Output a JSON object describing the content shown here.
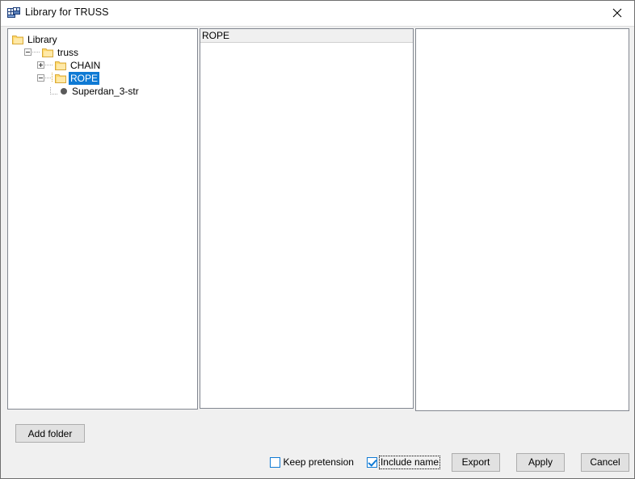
{
  "window": {
    "title": "Library for TRUSS",
    "icon": "library-window-icon",
    "close_label": "✕"
  },
  "tree_panel": {
    "name": "library-tree",
    "nodes": [
      {
        "label": "Library",
        "depth": 0,
        "icon": "folder-icon",
        "expander": "none",
        "selected": false
      },
      {
        "label": "truss",
        "depth": 1,
        "icon": "folder-icon",
        "expander": "minus",
        "selected": false
      },
      {
        "label": "CHAIN",
        "depth": 2,
        "icon": "folder-icon",
        "expander": "plus",
        "selected": false
      },
      {
        "label": "ROPE",
        "depth": 2,
        "icon": "folder-icon",
        "expander": "minus",
        "selected": true
      },
      {
        "label": "Superdan_3-str",
        "depth": 3,
        "icon": "bullet-icon",
        "expander": "none",
        "selected": false
      }
    ]
  },
  "list_panel": {
    "name": "item-list",
    "header": "ROPE",
    "items": []
  },
  "properties_panel": {
    "name": "properties-pane",
    "items": []
  },
  "toolbar": {
    "add_folder_label": "Add folder"
  },
  "options": {
    "keep_pretension": {
      "label": "Keep pretension",
      "checked": false,
      "focused": false
    },
    "include_name": {
      "label": "Include name",
      "checked": true,
      "focused": true
    }
  },
  "buttons": {
    "export_label": "Export",
    "apply_label": "Apply",
    "cancel_label": "Cancel"
  },
  "colors": {
    "selection_blue": "#0f7ad4",
    "folder_yellow": "#ffd96b",
    "window_chrome": "#f0f0f0",
    "panel_border": "#828790"
  }
}
